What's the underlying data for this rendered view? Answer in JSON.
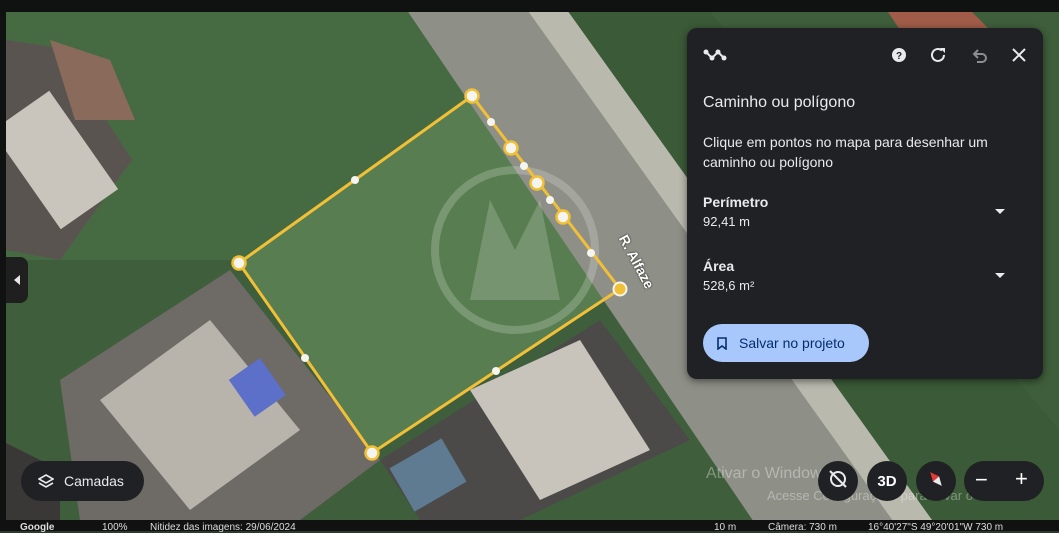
{
  "map": {
    "street_label": "R. Alfaze",
    "colors": {
      "grass": "#4a6b45",
      "road": "#8a8a82",
      "polygon": "#f3c13a"
    }
  },
  "panel": {
    "tool_icon": "path-tool-icon",
    "help_icon": "help-icon",
    "refresh_icon": "refresh-icon",
    "undo_icon": "undo-icon",
    "close_icon": "close-icon",
    "title": "Caminho ou polígono",
    "description": "Clique em pontos no mapa para desenhar um caminho ou polígono",
    "perimeter_label": "Perímetro",
    "perimeter_value": "92,41 m",
    "area_label": "Área",
    "area_value": "528,6 m²",
    "save_label": "Salvar no projeto"
  },
  "controls": {
    "layers_label": "Camadas",
    "three_d_label": "3D",
    "zoom_out": "−",
    "zoom_in": "+"
  },
  "watermark": {
    "line1": "Ativar o Windows",
    "line2": "Acesse Configurações para ativar o Windows."
  },
  "statusbar": {
    "brand": "Google",
    "zoom": "100%",
    "imagery": "Nitidez das imagens: 29/06/2024",
    "scale": "10 m",
    "camera": "Câmera: 730 m",
    "coords": "16°40'27\"S 49°20'01\"W  730 m"
  }
}
